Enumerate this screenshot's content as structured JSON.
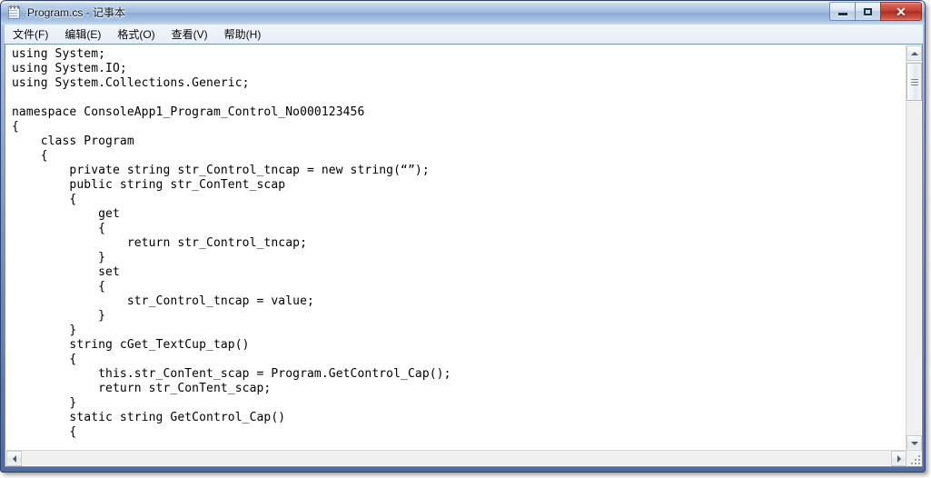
{
  "window": {
    "title": "Program.cs - 记事本",
    "icon": "notepad-icon",
    "controls": {
      "minimize_label": "–",
      "restore_label": "❐",
      "close_label": "✕"
    }
  },
  "menubar": {
    "items": [
      {
        "label": "文件(F)",
        "name": "menu-file"
      },
      {
        "label": "编辑(E)",
        "name": "menu-edit"
      },
      {
        "label": "格式(O)",
        "name": "menu-format"
      },
      {
        "label": "查看(V)",
        "name": "menu-view"
      },
      {
        "label": "帮助(H)",
        "name": "menu-help"
      }
    ]
  },
  "editor": {
    "content": "using System;\nusing System.IO;\nusing System.Collections.Generic;\n\nnamespace ConsoleApp1_Program_Control_No000123456\n{\n    class Program\n    {\n        private string str_Control_tncap = new string(“”);\n        public string str_ConTent_scap\n        {\n            get\n            {\n                return str_Control_tncap;\n            }\n            set\n            {\n                str_Control_tncap = value;\n            }\n        }\n        string cGet_TextCup_tap()\n        {\n            this.str_ConTent_scap = Program.GetControl_Cap();\n            return str_ConTent_scap;\n        }\n        static string GetControl_Cap()\n        {",
    "lines": [
      "using System;",
      "using System.IO;",
      "using System.Collections.Generic;",
      "",
      "namespace ConsoleApp1_Program_Control_No000123456",
      "{",
      "    class Program",
      "    {",
      "        private string str_Control_tncap = new string(“”);",
      "        public string str_ConTent_scap",
      "        {",
      "            get",
      "            {",
      "                return str_Control_tncap;",
      "            }",
      "            set",
      "            {",
      "                str_Control_tncap = value;",
      "            }",
      "        }",
      "        string cGet_TextCup_tap()",
      "        {",
      "            this.str_ConTent_scap = Program.GetControl_Cap();",
      "            return str_ConTent_scap;",
      "        }",
      "        static string GetControl_Cap()",
      "        {"
    ]
  },
  "scrollbars": {
    "vertical": {
      "up_icon": "arrow-up-icon",
      "down_icon": "arrow-down-icon",
      "thumb": "vertical-scroll-thumb"
    },
    "horizontal": {
      "left_icon": "arrow-left-icon",
      "right_icon": "arrow-right-icon"
    },
    "resize_grip": "resize-grip"
  },
  "colors": {
    "title_gradient_top": "#d9e6f5",
    "title_gradient_bottom": "#c6d9ef",
    "frame_border": "#2c4272",
    "close_button": "#c33f32",
    "client_background": "#ffffff",
    "text": "#000000"
  }
}
